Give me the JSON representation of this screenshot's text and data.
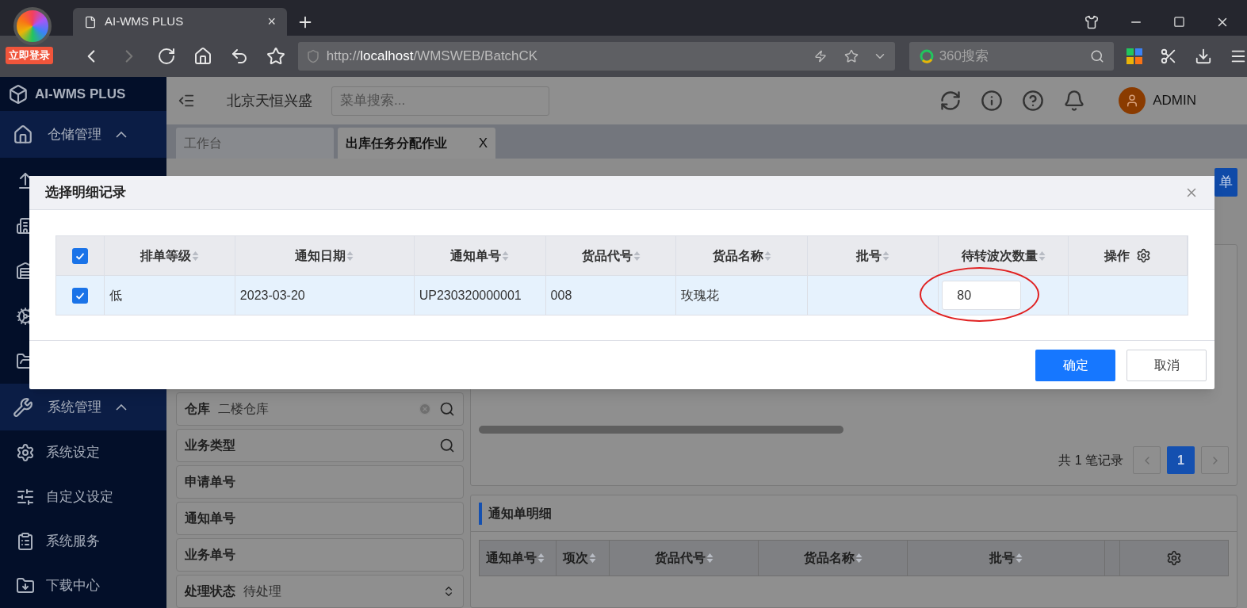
{
  "browser": {
    "login_badge": "立即登录",
    "tab_title": "AI-WMS PLUS",
    "tab_close": "×",
    "url_scheme": "http://",
    "url_host": "localhost",
    "url_path": "/WMSWEB/BatchCK",
    "search_placeholder": "360搜索"
  },
  "app": {
    "logo": "AI-WMS PLUS",
    "company": "北京天恒兴盛",
    "menu_search_placeholder": "菜单搜索...",
    "user": "ADMIN"
  },
  "sidebar": {
    "sections": [
      {
        "label": "仓储管理",
        "expanded": true
      },
      {
        "label": "系统管理",
        "expanded": true,
        "children": [
          {
            "label": "系统设定",
            "kind": "settings"
          },
          {
            "label": "自定义设定",
            "kind": "sliders"
          },
          {
            "label": "系统服务",
            "kind": "service"
          },
          {
            "label": "下载中心",
            "kind": "download"
          }
        ]
      }
    ]
  },
  "tabs": [
    {
      "label": "工作台",
      "selected": false
    },
    {
      "label": "出库任务分配作业",
      "selected": true,
      "close": "X"
    }
  ],
  "toolbar": {
    "buttons": [
      "单"
    ]
  },
  "filters": [
    {
      "label": "仓库",
      "value": "二楼仓库",
      "kind": "lookup",
      "clearable": true
    },
    {
      "label": "业务类型",
      "kind": "lookup",
      "clearable": false
    },
    {
      "label": "申请单号",
      "kind": "text",
      "clearable": false
    },
    {
      "label": "通知单号",
      "kind": "text",
      "clearable": false
    },
    {
      "label": "业务单号",
      "kind": "text",
      "clearable": false
    },
    {
      "label": "处理状态",
      "value": "待处理",
      "kind": "select",
      "clearable": false
    }
  ],
  "pagination": {
    "total": "共 1 笔记录",
    "pages": [
      {
        "label": "1",
        "selected": true
      }
    ]
  },
  "detail_panel": {
    "title": "通知单明细",
    "columns": [
      "通知单号",
      "项次",
      "货品代号",
      "货品名称",
      "批号"
    ]
  },
  "dialog": {
    "title": "选择明细记录",
    "all_checked": true,
    "columns": [
      {
        "label": "排单等级",
        "sortable": true
      },
      {
        "label": "通知日期",
        "sortable": true
      },
      {
        "label": "通知单号",
        "sortable": true
      },
      {
        "label": "货品代号",
        "sortable": true
      },
      {
        "label": "货品名称",
        "sortable": true
      },
      {
        "label": "批号",
        "sortable": true
      },
      {
        "label": "待转波次数量",
        "sortable": true
      },
      {
        "label": "操作",
        "sortable": false
      }
    ],
    "rows": [
      {
        "checked": true,
        "cells": [
          "低",
          "2023-03-20",
          "UP230320000001",
          "008",
          "玫瑰花"
        ],
        "quantity": "80"
      }
    ],
    "confirm": "确定",
    "cancel": "取消"
  }
}
